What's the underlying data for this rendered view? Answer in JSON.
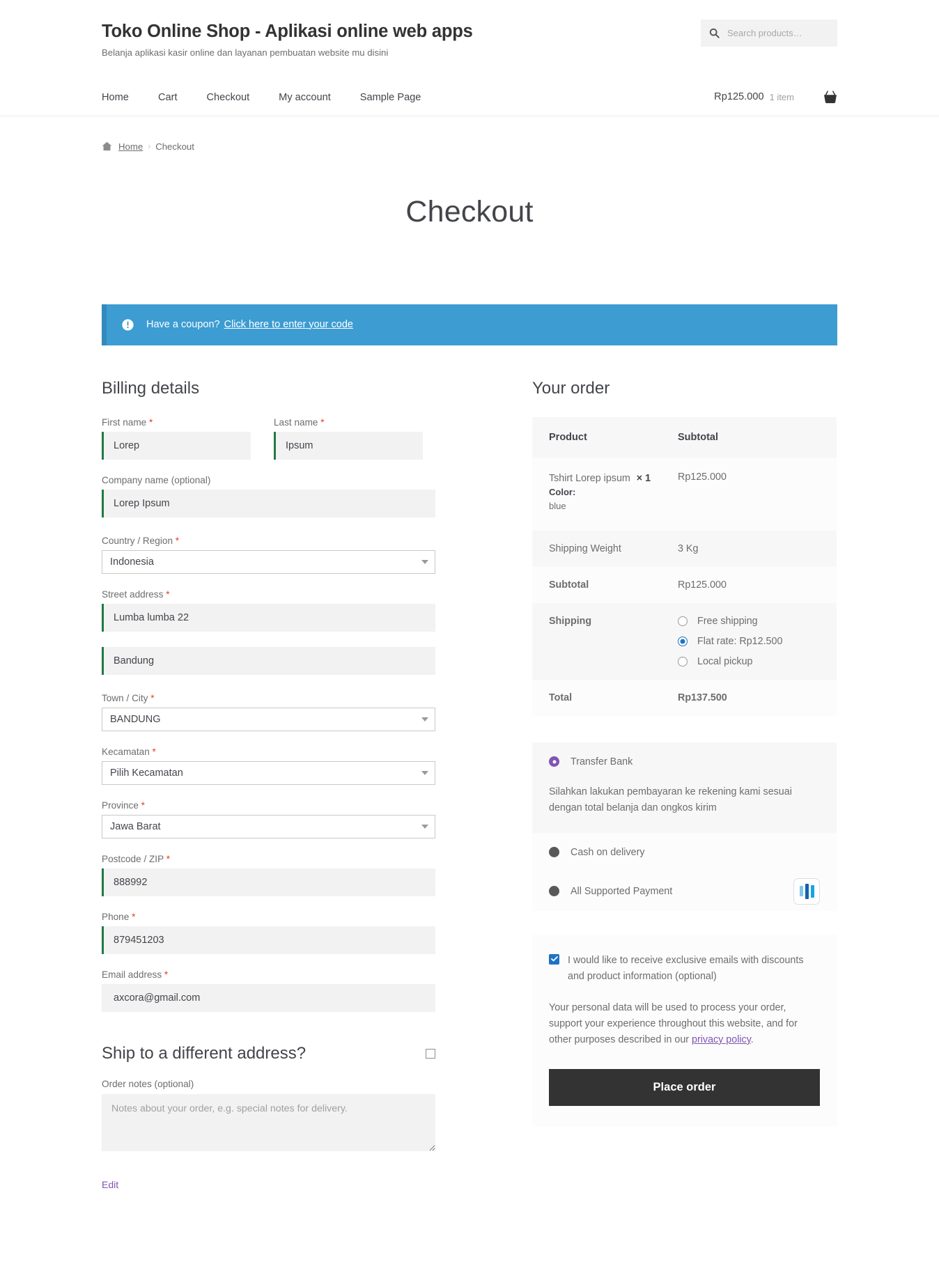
{
  "header": {
    "site_title": "Toko Online Shop - Aplikasi online web apps",
    "tagline": "Belanja aplikasi kasir online dan layanan pembuatan website mu disini",
    "search_placeholder": "Search products…",
    "search_value": ""
  },
  "nav": {
    "items": [
      {
        "label": "Home"
      },
      {
        "label": "Cart"
      },
      {
        "label": "Checkout"
      },
      {
        "label": "My account"
      },
      {
        "label": "Sample Page"
      }
    ],
    "cart_amount": "Rp125.000",
    "cart_count": "1 item"
  },
  "breadcrumb": {
    "home": "Home",
    "separator": "›",
    "current": "Checkout"
  },
  "page": {
    "title": "Checkout"
  },
  "coupon": {
    "text": "Have a coupon?",
    "link": "Click here to enter your code",
    "accent": "#3d9cd2"
  },
  "billing": {
    "title": "Billing details",
    "fields": {
      "first_name": {
        "label": "First name",
        "required": "*",
        "value": "Lorep"
      },
      "last_name": {
        "label": "Last name",
        "required": "*",
        "value": "Ipsum"
      },
      "company": {
        "label": "Company name (optional)",
        "value": "Lorep Ipsum"
      },
      "country": {
        "label": "Country / Region",
        "required": "*",
        "value": "Indonesia"
      },
      "street1": {
        "label": "Street address",
        "required": "*",
        "value": "Lumba lumba 22"
      },
      "street2": {
        "value": "Bandung"
      },
      "city": {
        "label": "Town / City",
        "required": "*",
        "value": "BANDUNG"
      },
      "kecamatan": {
        "label": "Kecamatan",
        "required": "*",
        "value": "Pilih Kecamatan"
      },
      "province": {
        "label": "Province",
        "required": "*",
        "value": "Jawa Barat"
      },
      "postcode": {
        "label": "Postcode / ZIP",
        "required": "*",
        "value": "888992"
      },
      "phone": {
        "label": "Phone",
        "required": "*",
        "value": "879451203"
      },
      "email": {
        "label": "Email address",
        "required": "*",
        "value": "axcora@gmail.com"
      }
    },
    "ship_different": {
      "title": "Ship to a different address?",
      "checked": false
    },
    "order_notes": {
      "label": "Order notes (optional)",
      "placeholder": "Notes about your order, e.g. special notes for delivery.",
      "value": ""
    },
    "edit_link": "Edit"
  },
  "order": {
    "title": "Your order",
    "columns": {
      "product": "Product",
      "subtotal": "Subtotal"
    },
    "items": [
      {
        "name": "Tshirt Lorep ipsum",
        "qty": "× 1",
        "subtotal": "Rp125.000",
        "variation_key": "Color:",
        "variation_value": "blue"
      }
    ],
    "shipping_weight": {
      "label": "Shipping Weight",
      "value": "3 Kg"
    },
    "subtotal": {
      "label": "Subtotal",
      "value": "Rp125.000"
    },
    "shipping": {
      "label": "Shipping",
      "methods": [
        {
          "label": "Free shipping",
          "selected": false
        },
        {
          "label": "Flat rate: Rp12.500",
          "selected": true
        },
        {
          "label": "Local pickup",
          "selected": false
        }
      ]
    },
    "total": {
      "label": "Total",
      "value": "Rp137.500"
    }
  },
  "payment": {
    "methods": [
      {
        "label": "Transfer Bank",
        "selected": true
      },
      {
        "label": "Cash on delivery",
        "selected": false
      },
      {
        "label": "All Supported Payment",
        "selected": false,
        "logo": "midtrans-logo"
      }
    ],
    "description": "Silahkan lakukan pembayaran ke rekening kami sesuai dengan total belanja dan ongkos kirim"
  },
  "terms": {
    "optin_label": "I would like to receive exclusive emails with discounts and product information (optional)",
    "optin_checked": true,
    "privacy_before": "Your personal data will be used to process your order, support your experience throughout this website, and for other purposes described in our ",
    "privacy_link": "privacy policy",
    "privacy_after": ".",
    "place_order": "Place order"
  }
}
